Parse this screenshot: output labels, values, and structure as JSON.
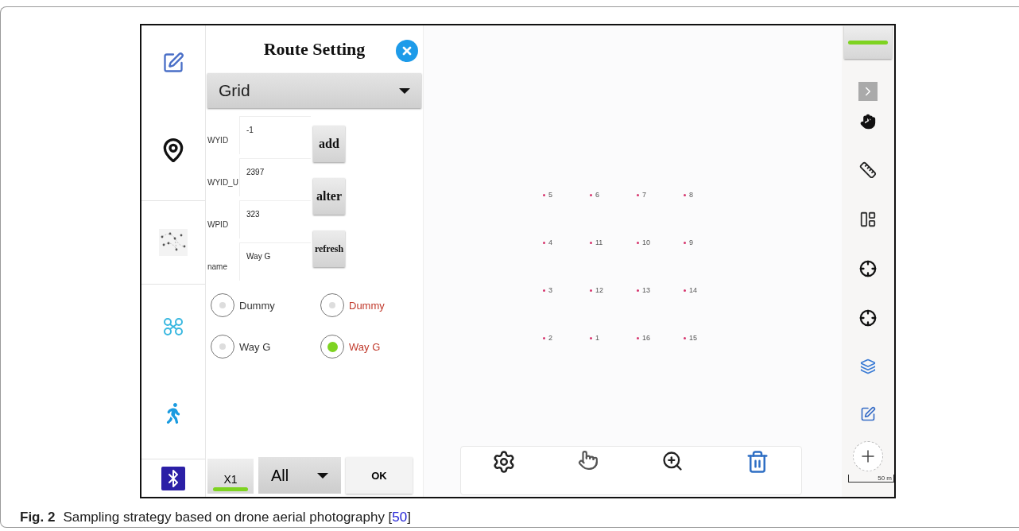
{
  "panel": {
    "title": "Route Setting",
    "route_type": "Grid",
    "fields": [
      {
        "label": "WYID",
        "value": "-1"
      },
      {
        "label": "WYID_U",
        "value": "2397"
      },
      {
        "label": "WPID",
        "value": "323"
      },
      {
        "label": "name",
        "value": "Way G"
      }
    ],
    "actions": [
      "add",
      "alter",
      "refresh"
    ],
    "options": [
      {
        "label": "Dummy",
        "selected": false,
        "color": "#333333"
      },
      {
        "label": "Dummy",
        "selected": false,
        "color": "#c0392b"
      },
      {
        "label": "Way G",
        "selected": false,
        "color": "#333333"
      },
      {
        "label": "Way G",
        "selected": true,
        "color": "#c0392b"
      }
    ],
    "speed": "X1",
    "filter": "All",
    "confirm": "OK"
  },
  "map": {
    "points": [
      "5",
      "6",
      "7",
      "8",
      "4",
      "11",
      "10",
      "9",
      "3",
      "12",
      "13",
      "14",
      "2",
      "1",
      "16",
      "15"
    ],
    "scale": "50 m"
  },
  "caption": {
    "label": "Fig. 2",
    "text": "Sampling strategy based on drone aerial photography [",
    "ref": "50",
    "end": "]"
  }
}
